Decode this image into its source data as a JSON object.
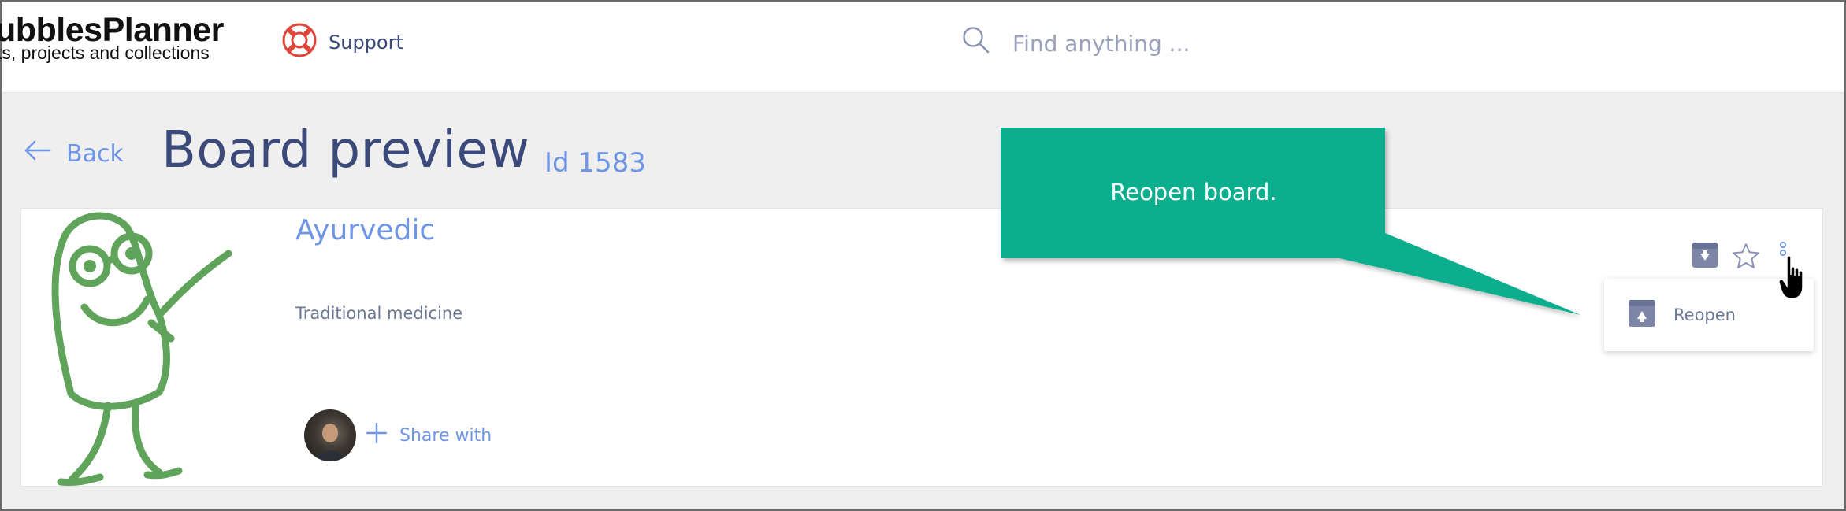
{
  "header": {
    "app_name": "ubblesPlanner",
    "app_tagline": "ts, projects and collections",
    "support_label": "Support",
    "search_placeholder": "Find anything ..."
  },
  "page": {
    "back_label": "Back",
    "title": "Board preview",
    "id_label": "Id 1583"
  },
  "board": {
    "name": "Ayurvedic",
    "description": "Traditional medicine",
    "share_label": "Share with"
  },
  "menu": {
    "items": [
      {
        "label": "Reopen",
        "icon": "archive-up-icon"
      }
    ]
  },
  "tooltip": {
    "text": "Reopen board."
  },
  "colors": {
    "accent": "#6f95e6",
    "title": "#3b4a7a",
    "callout": "#0bae8e",
    "mascot": "#5fa45a",
    "support_icon": "#e0453a"
  }
}
